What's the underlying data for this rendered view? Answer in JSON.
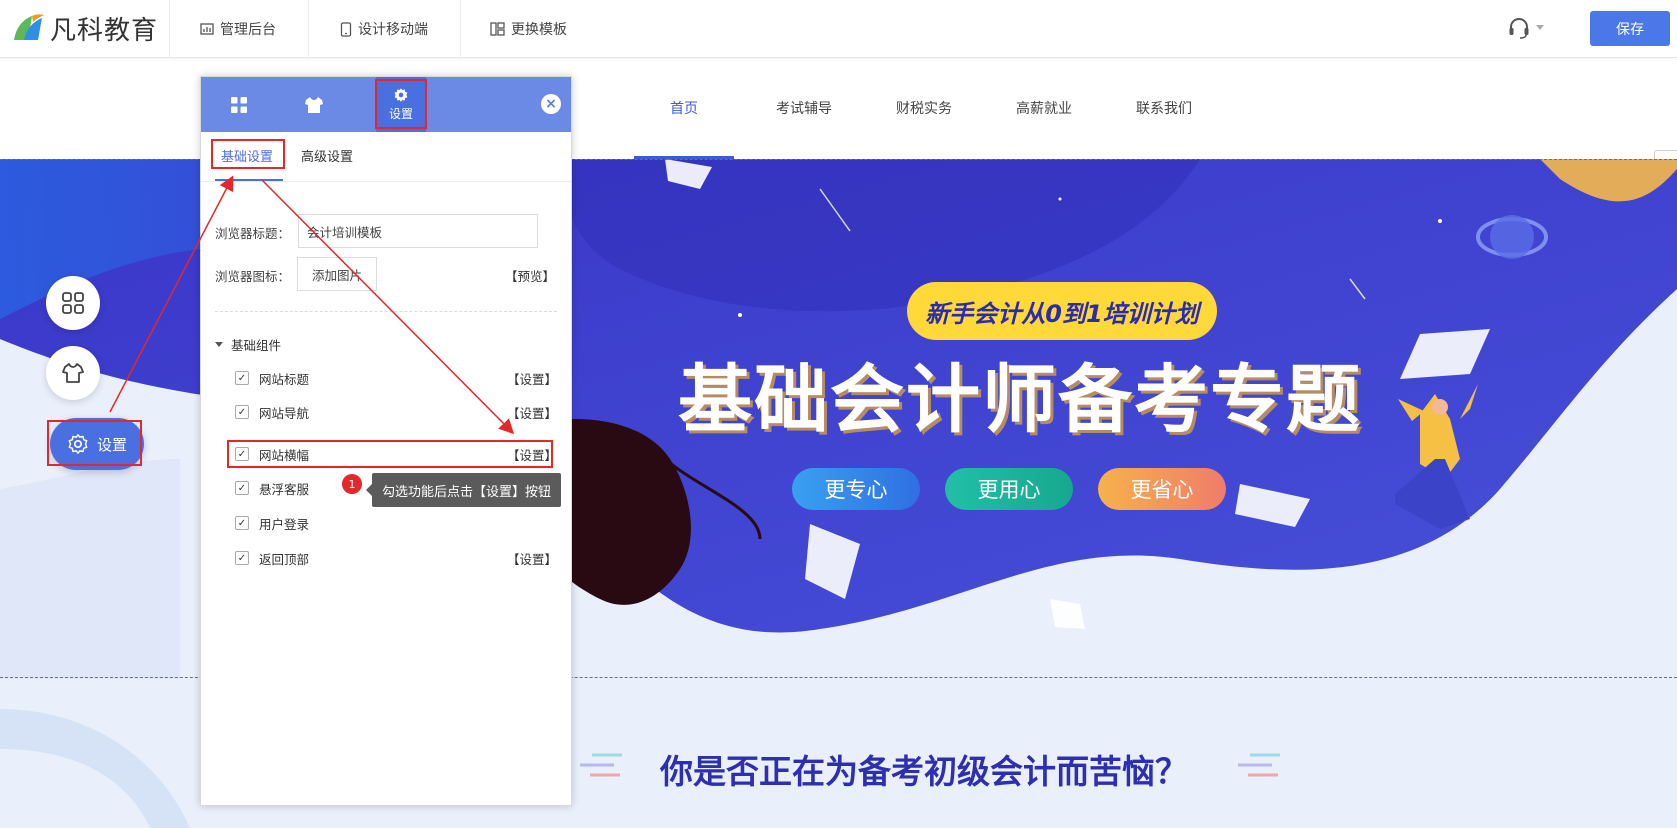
{
  "topbar": {
    "logo_text": "凡科教育",
    "menu": [
      {
        "label": "管理后台",
        "icon": "dashboard-icon"
      },
      {
        "label": "设计移动端",
        "icon": "mobile-icon"
      },
      {
        "label": "更换模板",
        "icon": "template-icon"
      }
    ],
    "save_label": "保存",
    "support_icon": "headset-icon"
  },
  "site_nav": {
    "items": [
      "首页",
      "考试辅导",
      "财税实务",
      "高薪就业",
      "联系我们"
    ],
    "active_index": 0
  },
  "banner": {
    "tag": "新手会计从0到1培训计划",
    "title": "基础会计师备考专题",
    "buttons": [
      "更专心",
      "更用心",
      "更省心"
    ]
  },
  "section": {
    "question": "你是否正在为备考初级会计而苦恼？"
  },
  "float_buttons": {
    "settings_label": "设置"
  },
  "panel": {
    "tabs": [
      {
        "icon": "grid-icon",
        "label": ""
      },
      {
        "icon": "shirt-icon",
        "label": ""
      },
      {
        "icon": "gear-icon",
        "label": "设置"
      }
    ],
    "sub_tabs": [
      "基础设置",
      "高级设置"
    ],
    "browser_title_label": "浏览器标题：",
    "browser_title_value": "会计培训模板",
    "browser_icon_label": "浏览器图标：",
    "add_image_label": "添加图片",
    "preview_label": "【预览】",
    "group_title": "基础组件",
    "components": [
      {
        "label": "网站标题",
        "checked": true,
        "action": "【设置】"
      },
      {
        "label": "网站导航",
        "checked": true,
        "action": "【设置】"
      },
      {
        "label": "网站横幅",
        "checked": true,
        "action": "【设置】"
      },
      {
        "label": "悬浮客服",
        "checked": true,
        "action": ""
      },
      {
        "label": "用户登录",
        "checked": true,
        "action": ""
      },
      {
        "label": "返回顶部",
        "checked": true,
        "action": "【设置】"
      }
    ]
  },
  "annotation": {
    "step": "1",
    "tooltip": "勾选功能后点击【设置】按钮"
  },
  "colors": {
    "accent": "#4a6fe0",
    "highlight": "#e3282a",
    "banner_blue": "#3b3fd0",
    "tag_yellow": "#ffd83a"
  }
}
